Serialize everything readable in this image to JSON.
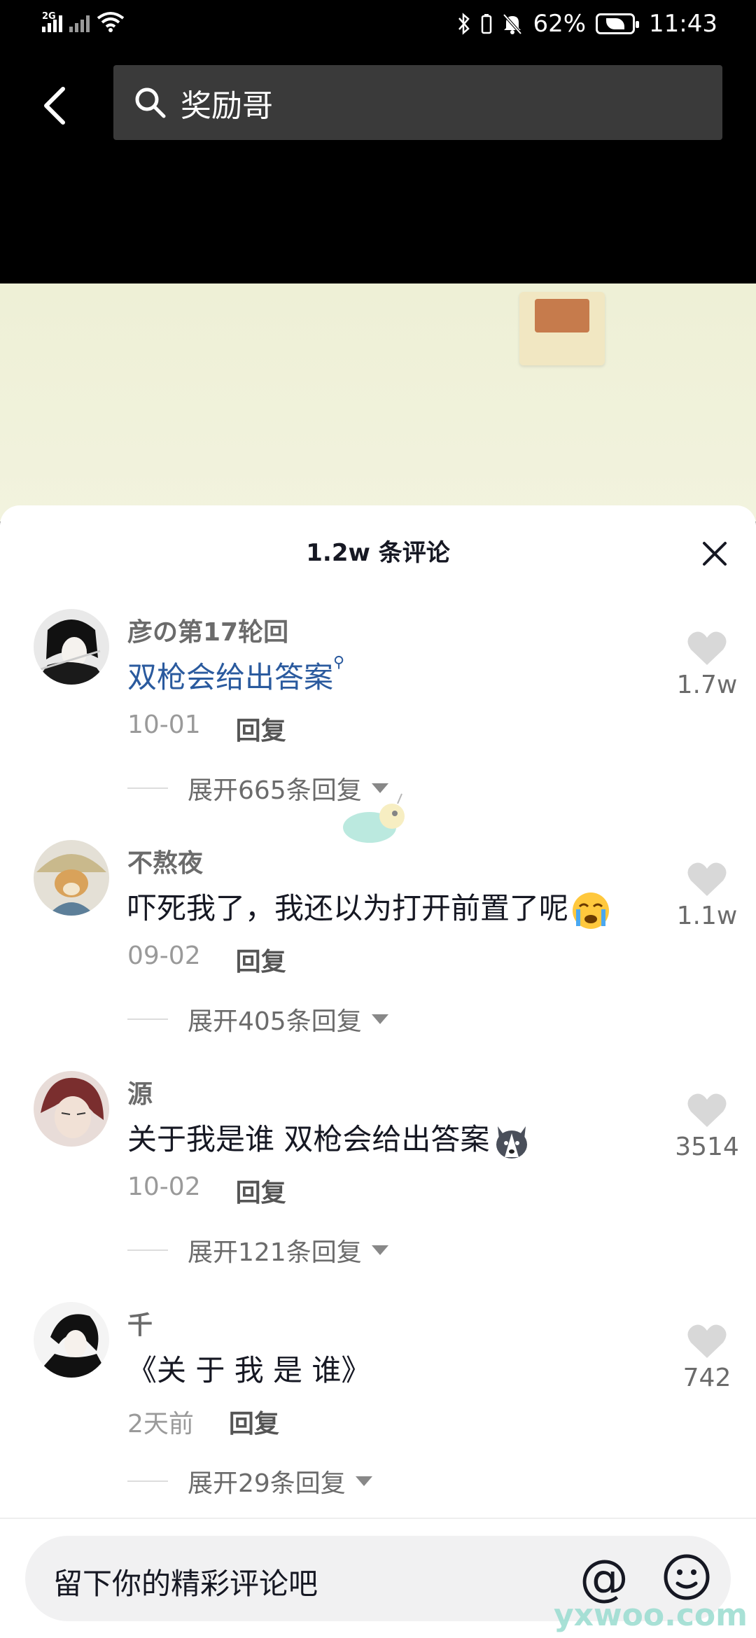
{
  "status_bar": {
    "network_1": "2G",
    "battery": "62%",
    "time": "11:43"
  },
  "search": {
    "query": "奖励哥"
  },
  "comments_panel": {
    "title": "1.2w 条评论",
    "comments": [
      {
        "username": "彦の第17轮回",
        "text": "双枪会给出答案",
        "date": "10-01",
        "reply": "回复",
        "expand": "展开665条回复",
        "likes": "1.7w"
      },
      {
        "username": "不熬夜",
        "text": "吓死我了，我还以为打开前置了呢",
        "date": "09-02",
        "reply": "回复",
        "expand": "展开405条回复",
        "likes": "1.1w"
      },
      {
        "username": "源",
        "text": "关于我是谁 双枪会给出答案",
        "date": "10-02",
        "reply": "回复",
        "expand": "展开121条回复",
        "likes": "3514"
      },
      {
        "username": "千",
        "text": "《关 于 我 是 谁》",
        "date": "2天前",
        "reply": "回复",
        "expand": "展开29条回复",
        "likes": "742"
      }
    ]
  },
  "input": {
    "placeholder": "留下你的精彩评论吧",
    "at_symbol": "@"
  },
  "watermark": "yxwoo.com",
  "colors": {
    "link": "#2a5a9e",
    "heart": "#d8d8d8"
  }
}
